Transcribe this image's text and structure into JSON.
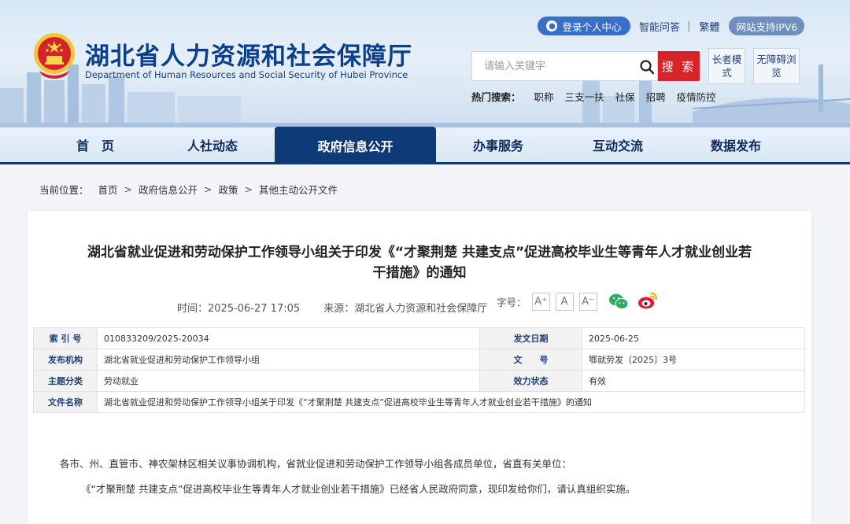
{
  "header": {
    "site_title": "湖北省人力资源和社会保障厅",
    "site_subtitle": "Department of Human Resources and Social Security of Hubei Province",
    "login_label": "登录个人中心",
    "qa_label": "智能问答",
    "separator": "|",
    "traditional_label": "繁體",
    "ipv6_label": "网站支持IPV6",
    "search": {
      "placeholder": "请输入关键字",
      "button_label": "搜 索"
    },
    "elder_mode_label": "长者模式",
    "accessible_label": "无障碍浏览",
    "hot_search": {
      "label": "热门搜索：",
      "items": [
        "职称",
        "三支一扶",
        "社保",
        "招聘",
        "疫情防控"
      ]
    }
  },
  "nav": {
    "items": [
      "首　页",
      "人社动态",
      "政府信息公开",
      "办事服务",
      "互动交流",
      "数据发布"
    ],
    "active_index": 2
  },
  "breadcrumb": {
    "label": "当前位置：",
    "items": [
      "首页",
      "政府信息公开",
      "政策",
      "其他主动公开文件"
    ],
    "sep": ">"
  },
  "article": {
    "title": "湖北省就业促进和劳动保护工作领导小组关于印发《“才聚荆楚 共建支点”促进高校毕业生等青年人才就业创业若干措施》的通知",
    "time": "时间：2025-06-27 17:05",
    "source": "来源：湖北省人力资源和社会保障厅",
    "font_size_label": "字号：",
    "font_buttons": [
      "A⁺",
      "A",
      "A⁻"
    ],
    "info_table": {
      "index_label": "索 引 号",
      "index_value": "010833209/2025-20034",
      "date_label": "发文日期",
      "date_value": "2025-06-25",
      "org_label": "发布机构",
      "org_value": "湖北省就业促进和劳动保护工作领导小组",
      "docno_label": "文　　号",
      "docno_value": "鄂就劳发〔2025〕3号",
      "topic_label": "主题分类",
      "topic_value": "劳动就业",
      "status_label": "效力状态",
      "status_value": "有效",
      "name_label": "文件名称",
      "name_value": "湖北省就业促进和劳动保护工作领导小组关于印发《“才聚荆楚 共建支点”促进高校毕业生等青年人才就业创业若干措施》的通知"
    },
    "para1": "各市、州、直管市、神农架林区相关议事协调机构，省就业促进和劳动保护工作领导小组各成员单位，省直有关单位：",
    "para2": "《“才聚荆楚  共建支点”促进高校毕业生等青年人才就业创业若干措施》已经省人民政府同意，现印发给你们，请认真组织实施。"
  },
  "colors": {
    "brand_blue": "#0f3a78",
    "search_red": "#d7232a",
    "login_blue": "#3a6fc8",
    "wechat_green": "#2aae67",
    "weibo_red": "#e6162d",
    "weibo_orange": "#f5a623"
  }
}
